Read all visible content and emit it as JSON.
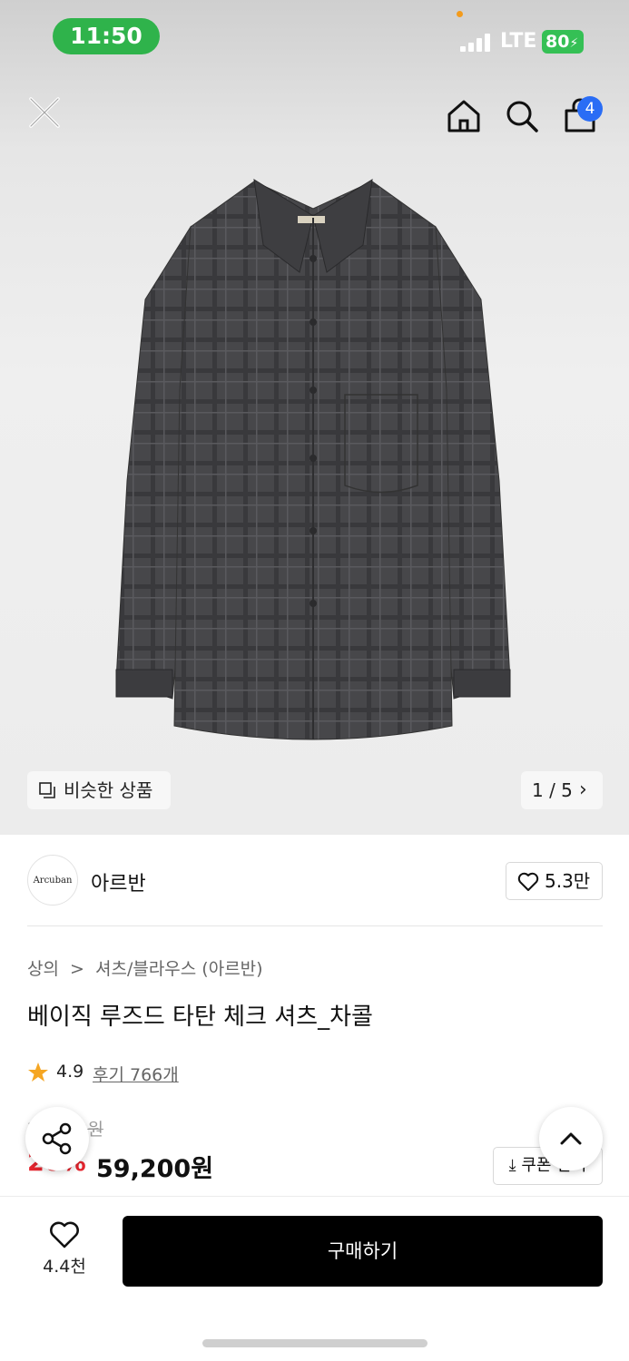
{
  "status_bar": {
    "time": "11:50",
    "network": "LTE",
    "battery": "80"
  },
  "top_bar": {
    "cart_count": "4"
  },
  "gallery": {
    "similar_label": "비슷한 상품",
    "pager": "1 / 5"
  },
  "brand": {
    "logo_text": "Arcuban",
    "name": "아르반",
    "likes": "5.3만"
  },
  "breadcrumb": [
    "상의",
    ">",
    "셔츠/블라우스 (아르반)"
  ],
  "product": {
    "title": "베이직 루즈드 타탄 체크 셔츠_차콜",
    "rating": "4.9",
    "reviews": "후기 766개",
    "original_price": "74,000원",
    "discount": "20%",
    "sale_price": "59,200원",
    "coupon_label": "⤓ 쿠폰 받기"
  },
  "bottom_bar": {
    "wish_count": "4.4천",
    "buy_label": "구매하기"
  },
  "colors": {
    "accent": "#2fb34b",
    "discount": "#e5252e",
    "badge": "#2a6df5",
    "buy": "#000000",
    "star": "#f5a623"
  }
}
